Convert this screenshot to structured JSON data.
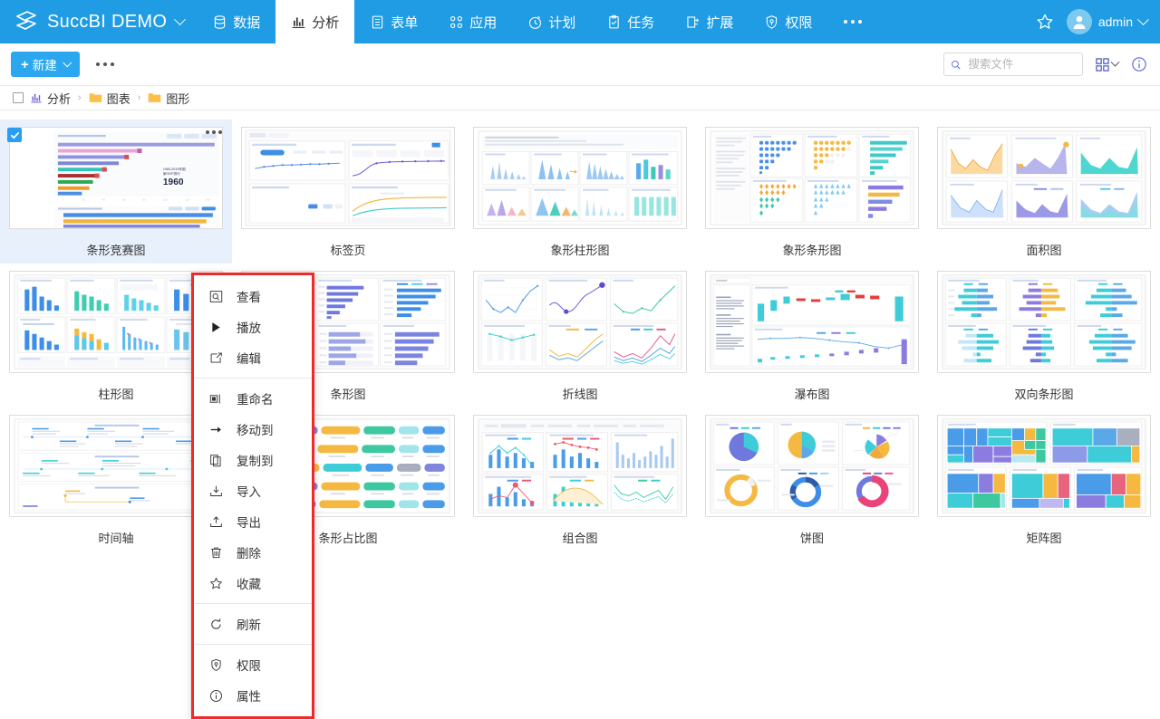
{
  "topnav": {
    "brand": "SuccBI DEMO",
    "items": [
      {
        "label": "数据",
        "icon": "database-icon",
        "active": false
      },
      {
        "label": "分析",
        "icon": "analytics-icon",
        "active": true
      },
      {
        "label": "表单",
        "icon": "form-icon",
        "active": false
      },
      {
        "label": "应用",
        "icon": "apps-icon",
        "active": false
      },
      {
        "label": "计划",
        "icon": "clock-icon",
        "active": false
      },
      {
        "label": "任务",
        "icon": "task-icon",
        "active": false
      },
      {
        "label": "扩展",
        "icon": "extension-icon",
        "active": false
      },
      {
        "label": "权限",
        "icon": "shield-icon",
        "active": false
      }
    ],
    "more_label": "…",
    "user": "admin",
    "accent": "#1f9ce4"
  },
  "toolbar": {
    "new_label": "新建",
    "more_label": "…",
    "search_placeholder": "搜索文件",
    "search_value": ""
  },
  "breadcrumb": {
    "items": [
      {
        "label": "分析",
        "icon": "analytics-icon"
      },
      {
        "label": "图表",
        "icon": "folder-icon"
      },
      {
        "label": "图形",
        "icon": "folder-icon"
      }
    ],
    "separator": "›"
  },
  "context_menu": {
    "border_color": "#f02929",
    "groups": [
      [
        {
          "label": "查看",
          "icon": "view-icon"
        },
        {
          "label": "播放",
          "icon": "play-icon"
        },
        {
          "label": "编辑",
          "icon": "edit-icon"
        }
      ],
      [
        {
          "label": "重命名",
          "icon": "rename-icon"
        },
        {
          "label": "移动到",
          "icon": "move-arrow-icon"
        },
        {
          "label": "复制到",
          "icon": "copy-icon"
        },
        {
          "label": "导入",
          "icon": "import-icon"
        },
        {
          "label": "导出",
          "icon": "export-icon"
        },
        {
          "label": "删除",
          "icon": "trash-icon"
        },
        {
          "label": "收藏",
          "icon": "star-icon"
        }
      ],
      [
        {
          "label": "刷新",
          "icon": "refresh-icon"
        }
      ],
      [
        {
          "label": "权限",
          "icon": "shield-icon"
        },
        {
          "label": "属性",
          "icon": "info-icon"
        }
      ]
    ]
  },
  "files": [
    {
      "label": "条形竞赛图",
      "selected": true,
      "thumb": "bar-race"
    },
    {
      "label": "标签页",
      "selected": false,
      "thumb": "tabs"
    },
    {
      "label": "象形柱形图",
      "selected": false,
      "thumb": "pictorial-column"
    },
    {
      "label": "象形条形图",
      "selected": false,
      "thumb": "pictorial-bar"
    },
    {
      "label": "面积图",
      "selected": false,
      "thumb": "area"
    },
    {
      "label": "柱形图",
      "selected": false,
      "thumb": "column"
    },
    {
      "label": "条形图",
      "selected": false,
      "thumb": "bar"
    },
    {
      "label": "折线图",
      "selected": false,
      "thumb": "line"
    },
    {
      "label": "瀑布图",
      "selected": false,
      "thumb": "waterfall"
    },
    {
      "label": "双向条形图",
      "selected": false,
      "thumb": "bidirectional-bar"
    },
    {
      "label": "时间轴",
      "selected": false,
      "thumb": "timeline"
    },
    {
      "label": "条形占比图",
      "selected": false,
      "thumb": "bar-ratio"
    },
    {
      "label": "组合图",
      "selected": false,
      "thumb": "combo"
    },
    {
      "label": "饼图",
      "selected": false,
      "thumb": "pie"
    },
    {
      "label": "矩阵图",
      "selected": false,
      "thumb": "treemap"
    }
  ]
}
